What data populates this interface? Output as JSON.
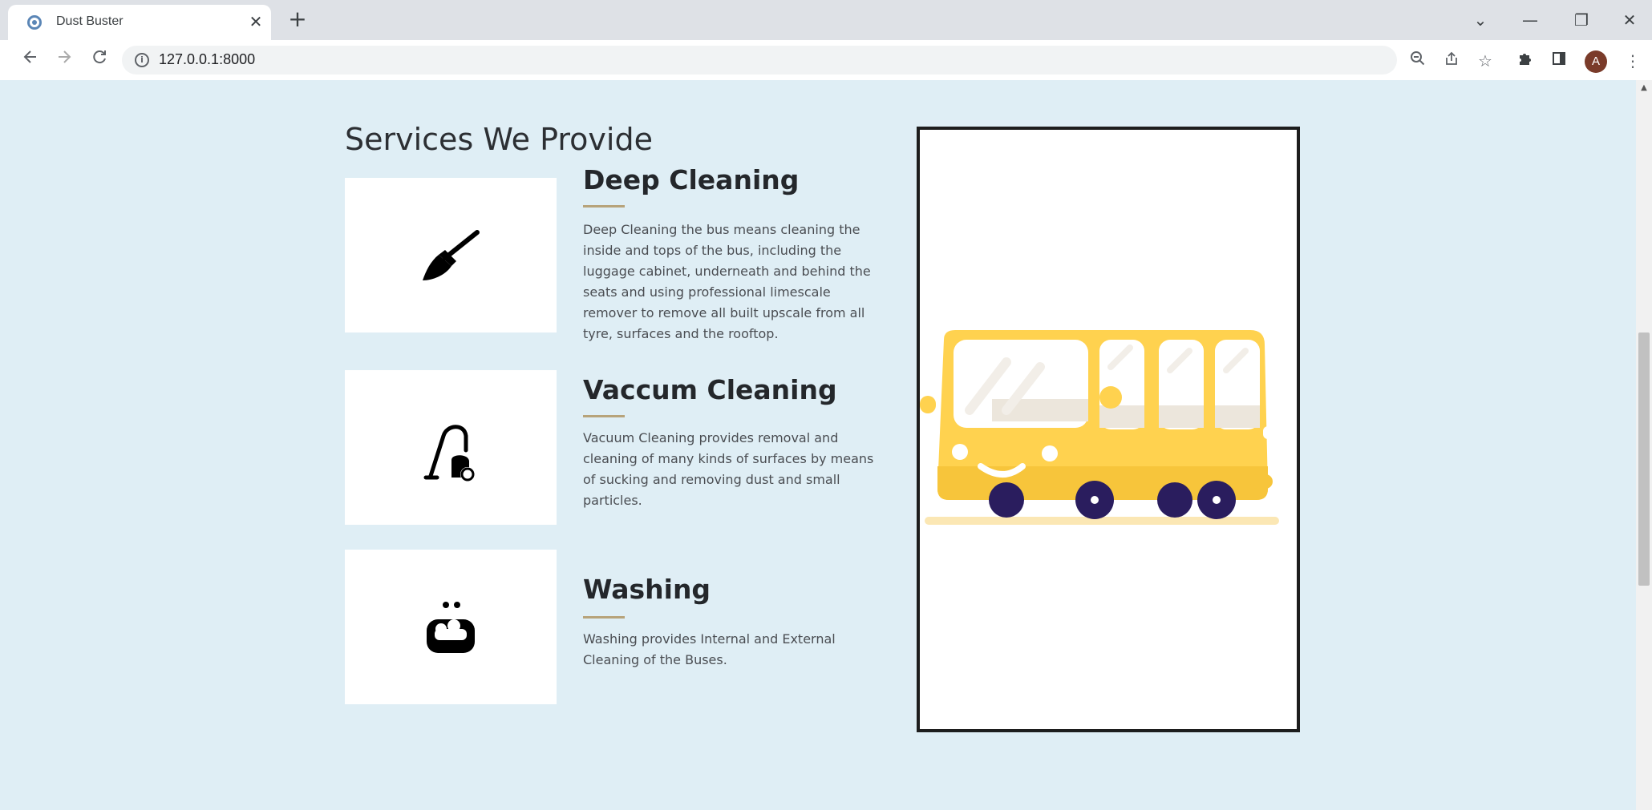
{
  "browser": {
    "tab_title": "Dust Buster",
    "tab_close": "✕",
    "new_tab": "+",
    "url": "127.0.0.1:8000",
    "avatar_letter": "A",
    "window_controls": {
      "minimize": "—",
      "restore": "❐",
      "close": "✕",
      "tab_search": "⌄"
    }
  },
  "page": {
    "section_title": "Services We Provide",
    "services": [
      {
        "title": "Deep Cleaning",
        "icon": "broom-icon",
        "description": "Deep Cleaning the bus means cleaning the inside and tops of the bus, including the luggage cabinet, underneath and behind the seats and using professional limescale remover to remove all built upscale from all tyre, surfaces and the rooftop."
      },
      {
        "title": "Vaccum Cleaning",
        "icon": "vacuum-cleaner-icon",
        "description": "Vacuum Cleaning provides removal and cleaning of many kinds of surfaces by means of sucking and removing dust and small particles."
      },
      {
        "title": "Washing",
        "icon": "soap-bubbles-icon",
        "description": "Washing provides Internal and External Cleaning of the Buses."
      }
    ],
    "illustration": "bus-illustration"
  },
  "colors": {
    "page_background": "#dfeef5",
    "accent_rule": "#b7a37a",
    "bus_yellow": "#ffd24f",
    "wheel_navy": "#2a1d5e"
  }
}
